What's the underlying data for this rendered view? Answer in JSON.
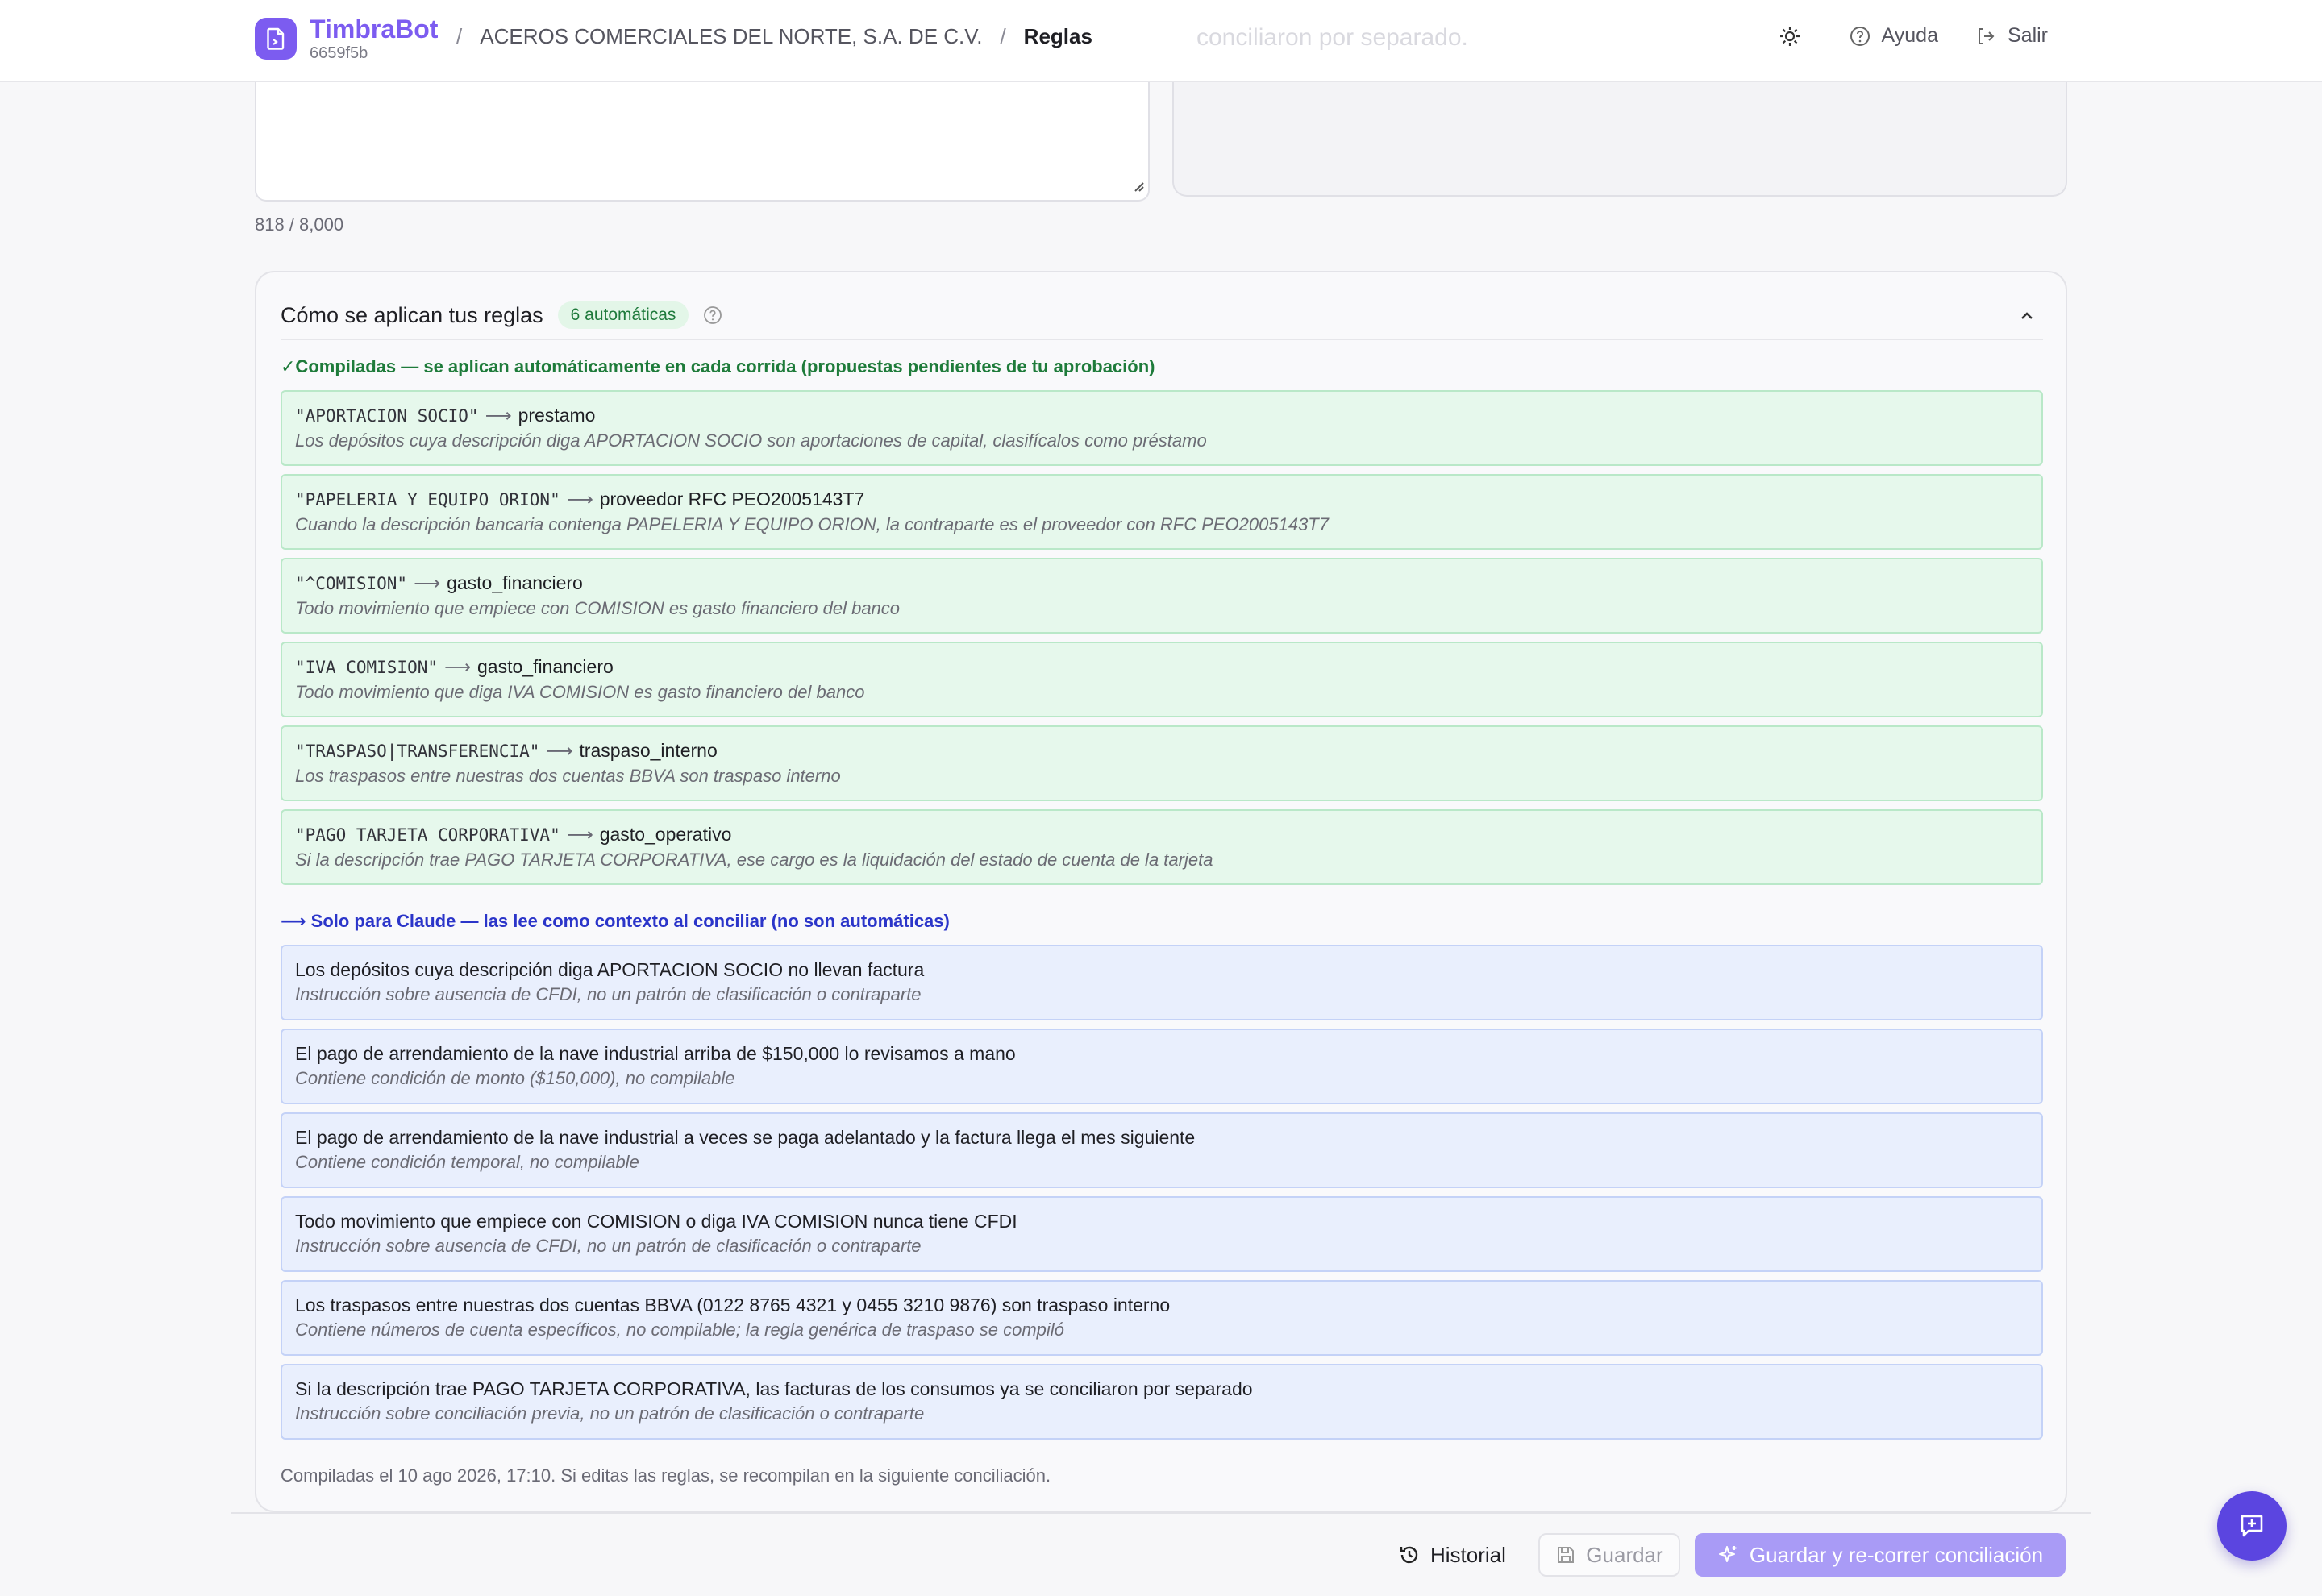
{
  "header": {
    "brand_name": "TimbraBot",
    "brand_id": "6659f5b",
    "breadcrumb_company": "ACEROS COMERCIALES DEL NORTE, S.A. DE C.V.",
    "breadcrumb_sep": "/",
    "breadcrumb_current": "Reglas",
    "help_label": "Ayuda",
    "logout_label": "Salir",
    "faded_text": "conciliaron por separado."
  },
  "editor": {
    "char_count": "818 / 8,000"
  },
  "panel": {
    "title": "Cómo se aplican tus reglas",
    "badge": "6 automáticas",
    "compiled_heading": "✓Compiladas — se aplican automáticamente en cada corrida (propuestas pendientes de tu aprobación)",
    "claude_heading": "⟶ Solo para Claude — las lee como contexto al conciliar (no son automáticas)",
    "arrow": "⟶",
    "compiled_rules": [
      {
        "pattern": "\"APORTACION SOCIO\"",
        "target": "prestamo",
        "description": "Los depósitos cuya descripción diga APORTACION SOCIO son aportaciones de capital, clasifícalos como préstamo"
      },
      {
        "pattern": "\"PAPELERIA Y EQUIPO ORION\"",
        "target": "proveedor RFC PEO2005143T7",
        "description": "Cuando la descripción bancaria contenga PAPELERIA Y EQUIPO ORION, la contraparte es el proveedor con RFC PEO2005143T7"
      },
      {
        "pattern": "\"^COMISION\"",
        "target": "gasto_financiero",
        "description": "Todo movimiento que empiece con COMISION es gasto financiero del banco"
      },
      {
        "pattern": "\"IVA COMISION\"",
        "target": "gasto_financiero",
        "description": "Todo movimiento que diga IVA COMISION es gasto financiero del banco"
      },
      {
        "pattern": "\"TRASPASO|TRANSFERENCIA\"",
        "target": "traspaso_interno",
        "description": "Los traspasos entre nuestras dos cuentas BBVA son traspaso interno"
      },
      {
        "pattern": "\"PAGO TARJETA CORPORATIVA\"",
        "target": "gasto_operativo",
        "description": "Si la descripción trae PAGO TARJETA CORPORATIVA, ese cargo es la liquidación del estado de cuenta de la tarjeta"
      }
    ],
    "claude_rules": [
      {
        "text": "Los depósitos cuya descripción diga APORTACION SOCIO no llevan factura",
        "reason": "Instrucción sobre ausencia de CFDI, no un patrón de clasificación o contraparte"
      },
      {
        "text": "El pago de arrendamiento de la nave industrial arriba de $150,000 lo revisamos a mano",
        "reason": "Contiene condición de monto ($150,000), no compilable"
      },
      {
        "text": "El pago de arrendamiento de la nave industrial a veces se paga adelantado y la factura llega el mes siguiente",
        "reason": "Contiene condición temporal, no compilable"
      },
      {
        "text": "Todo movimiento que empiece con COMISION o diga IVA COMISION nunca tiene CFDI",
        "reason": "Instrucción sobre ausencia de CFDI, no un patrón de clasificación o contraparte"
      },
      {
        "text": "Los traspasos entre nuestras dos cuentas BBVA (0122 8765 4321 y 0455 3210 9876) son traspaso interno",
        "reason": "Contiene números de cuenta específicos, no compilable; la regla genérica de traspaso se compiló"
      },
      {
        "text": "Si la descripción trae PAGO TARJETA CORPORATIVA, las facturas de los consumos ya se conciliaron por separado",
        "reason": "Instrucción sobre conciliación previa, no un patrón de clasificación o contraparte"
      }
    ],
    "footnote": "Compiladas el 10 ago 2026, 17:10. Si editas las reglas, se recompilan en la siguiente conciliación."
  },
  "actions": {
    "history_label": "Historial",
    "save_label": "Guardar",
    "rerun_label": "Guardar y re-correr conciliación"
  },
  "colors": {
    "brand": "#7c5cf0",
    "compiled_green": "#1e7b3a",
    "claude_blue": "#2b35c9",
    "primary_disabled": "#a99bf6",
    "fab": "#5b45e0"
  }
}
